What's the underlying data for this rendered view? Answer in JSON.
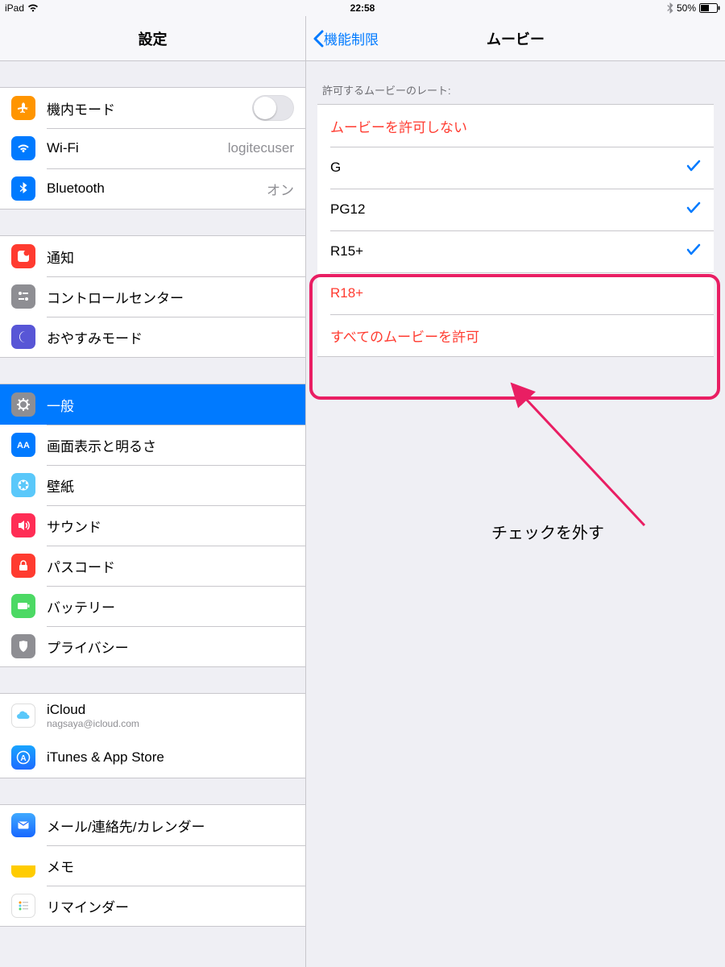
{
  "statusbar": {
    "device": "iPad",
    "time": "22:58",
    "battery": "50%"
  },
  "sidebar": {
    "title": "設定",
    "group1": {
      "airplane": {
        "label": "機内モード"
      },
      "wifi": {
        "label": "Wi-Fi",
        "value": "logitecuser"
      },
      "bluetooth": {
        "label": "Bluetooth",
        "value": "オン"
      }
    },
    "group2": {
      "notifications": "通知",
      "controlcenter": "コントロールセンター",
      "dnd": "おやすみモード"
    },
    "group3": {
      "general": "一般",
      "display": "画面表示と明るさ",
      "wallpaper": "壁紙",
      "sounds": "サウンド",
      "passcode": "パスコード",
      "battery": "バッテリー",
      "privacy": "プライバシー"
    },
    "group4": {
      "icloud_label": "iCloud",
      "icloud_sub": "nagsaya@icloud.com",
      "itunes": "iTunes & App Store"
    },
    "group5": {
      "mail": "メール/連絡先/カレンダー",
      "notes": "メモ",
      "reminders": "リマインダー"
    }
  },
  "detail": {
    "back": "機能制限",
    "title": "ムービー",
    "section_header": "許可するムービーのレート:",
    "ratings": [
      {
        "label": "ムービーを許可しない",
        "restricted": true,
        "checked": false
      },
      {
        "label": "G",
        "restricted": false,
        "checked": true
      },
      {
        "label": "PG12",
        "restricted": false,
        "checked": true
      },
      {
        "label": "R15+",
        "restricted": false,
        "checked": true
      },
      {
        "label": "R18+",
        "restricted": true,
        "checked": false
      },
      {
        "label": "すべてのムービーを許可",
        "restricted": true,
        "checked": false
      }
    ]
  },
  "annotation": {
    "text": "チェックを外す"
  }
}
